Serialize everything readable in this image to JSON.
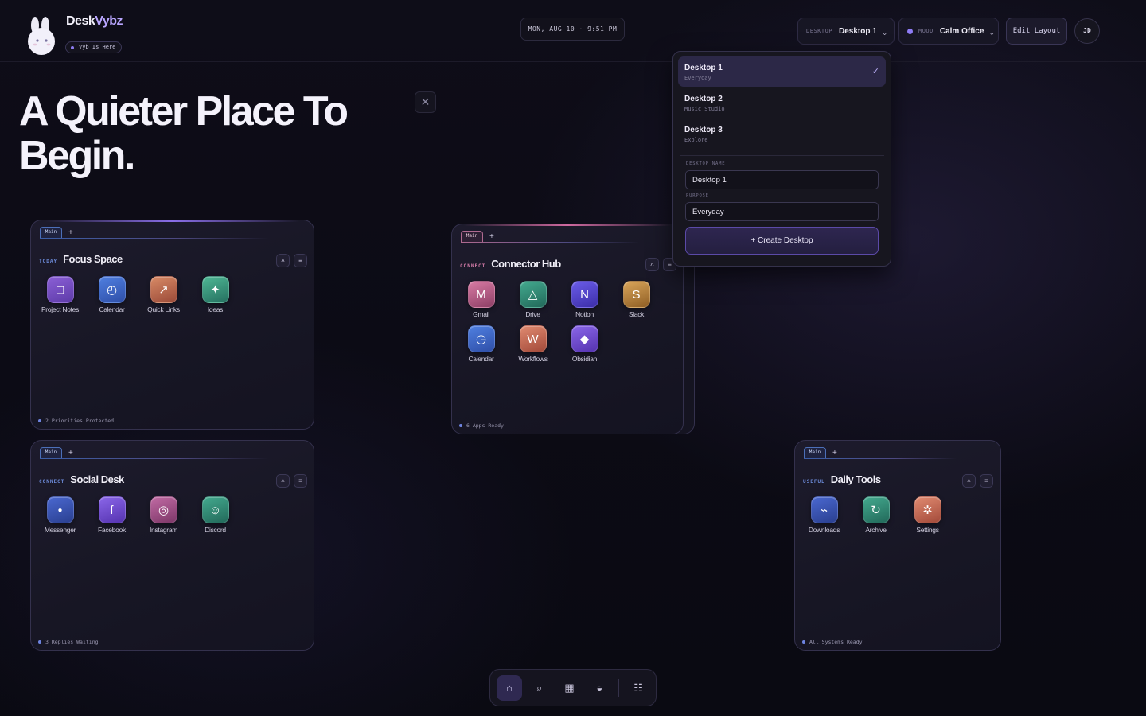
{
  "brand": {
    "name_a": "Desk",
    "name_b": "Vybz",
    "status": "Vyb Is Here"
  },
  "clock": "MON, AUG 10 · 9:51 PM",
  "header": {
    "desktop_label": "DESKTOP",
    "desktop_value": "Desktop 1",
    "mood_label": "MOOD",
    "mood_value": "Calm Office",
    "edit_layout": "Edit Layout",
    "avatar": "JD"
  },
  "hero": {
    "line1": "A Quieter Place To",
    "line2": "Begin.",
    "close": "✕"
  },
  "widgets": {
    "focus": {
      "tab": "Main",
      "eyebrow": "TODAY",
      "title": "Focus Space",
      "footer": "2 Priorities Protected",
      "apps": [
        {
          "label": "Project Notes",
          "glyph": "□",
          "icon": "notes-icon"
        },
        {
          "label": "Calendar",
          "glyph": "◴",
          "icon": "calendar-icon"
        },
        {
          "label": "Quick Links",
          "glyph": "↗",
          "icon": "link-icon"
        },
        {
          "label": "Ideas",
          "glyph": "✦",
          "icon": "sparkle-icon"
        }
      ]
    },
    "connector": {
      "tab": "Main",
      "eyebrow": "CONNECT",
      "title": "Connector Hub",
      "footer": "6 Apps Ready",
      "apps": [
        {
          "label": "Gmail",
          "glyph": "M",
          "icon": "gmail-icon"
        },
        {
          "label": "Drive",
          "glyph": "△",
          "icon": "drive-icon"
        },
        {
          "label": "Notion",
          "glyph": "N",
          "icon": "notion-icon"
        },
        {
          "label": "Slack",
          "glyph": "S",
          "icon": "slack-icon"
        },
        {
          "label": "Calendar",
          "glyph": "◷",
          "icon": "calendar-icon"
        },
        {
          "label": "Workflows",
          "glyph": "W",
          "icon": "workflows-icon"
        },
        {
          "label": "Obsidian",
          "glyph": "◆",
          "icon": "obsidian-icon"
        }
      ]
    },
    "social": {
      "tab": "Main",
      "eyebrow": "CONNECT",
      "title": "Social Desk",
      "footer": "3 Replies Waiting",
      "apps": [
        {
          "label": "Messenger",
          "glyph": "●",
          "icon": "messenger-icon"
        },
        {
          "label": "Facebook",
          "glyph": "f",
          "icon": "facebook-icon"
        },
        {
          "label": "Instagram",
          "glyph": "◎",
          "icon": "instagram-icon"
        },
        {
          "label": "Discord",
          "glyph": "☺",
          "icon": "discord-icon"
        }
      ]
    },
    "daily": {
      "tab": "Main",
      "eyebrow": "USEFUL",
      "title": "Daily Tools",
      "footer": "All Systems Ready",
      "apps": [
        {
          "label": "Downloads",
          "glyph": "⌁",
          "icon": "download-icon"
        },
        {
          "label": "Archive",
          "glyph": "↻",
          "icon": "archive-icon"
        },
        {
          "label": "Settings",
          "glyph": "✲",
          "icon": "settings-icon"
        }
      ]
    }
  },
  "dropdown": {
    "items": [
      {
        "name": "Desktop 1",
        "sub": "Everyday"
      },
      {
        "name": "Desktop 2",
        "sub": "Music Studio"
      },
      {
        "name": "Desktop 3",
        "sub": "Explore"
      }
    ],
    "name_label": "DESKTOP NAME",
    "name_value": "Desktop 1",
    "purpose_label": "PURPOSE",
    "purpose_value": "Everyday",
    "create": "+ Create Desktop"
  },
  "dock": [
    "home-icon",
    "search-icon",
    "grid-icon",
    "theme-icon",
    "list-icon"
  ],
  "colors": {
    "accent": "#8e7cf5",
    "background": "#0e0d18",
    "widget_border": "#34314d"
  }
}
